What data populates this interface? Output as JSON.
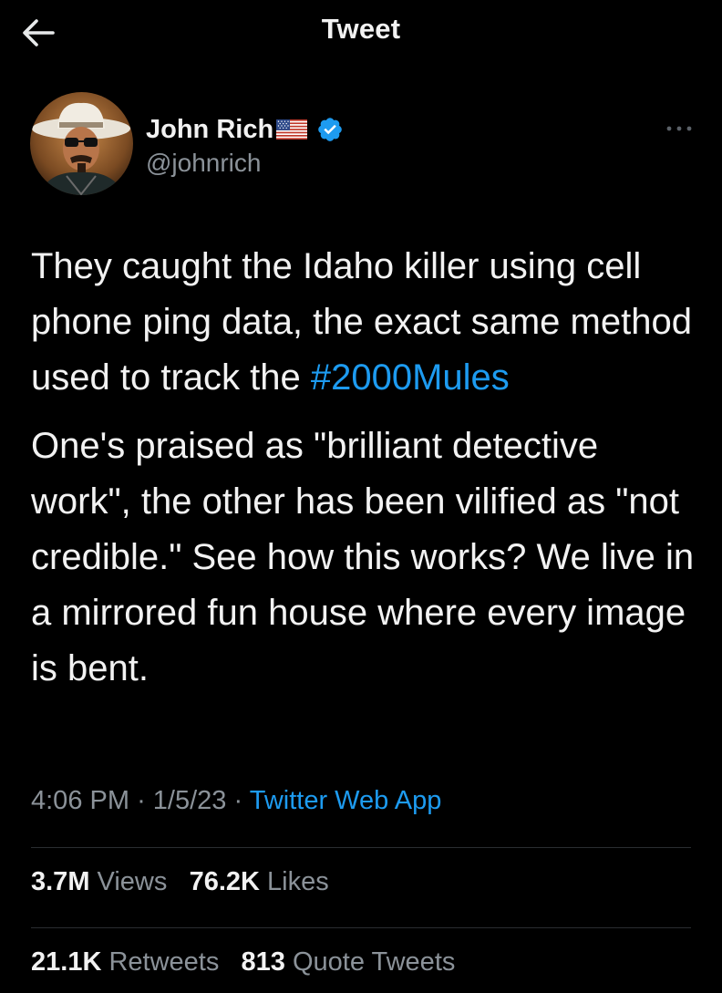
{
  "header": {
    "title": "Tweet",
    "back_icon": "arrow-left-icon"
  },
  "author": {
    "display_name": "John Rich",
    "handle": "@johnrich",
    "flag_icon": "us-flag-icon",
    "verified_icon": "verified-badge-icon",
    "verified_color": "#1d9bf0"
  },
  "tweet": {
    "paragraph1_text": "They caught the Idaho killer using cell phone ping data, the exact same method used to track the",
    "hashtag": "#2000Mules",
    "paragraph2": "One's praised as \"brilliant detective work\", the other has been vilified as \"not credible.\" See how this works? We live in a mirrored fun house where every image is bent."
  },
  "meta": {
    "time": "4:06 PM",
    "separator": "·",
    "date": "1/5/23",
    "source": "Twitter Web App"
  },
  "stats": {
    "views_count": "3.7M",
    "views_label": "Views",
    "likes_count": "76.2K",
    "likes_label": "Likes",
    "retweets_count": "21.1K",
    "retweets_label": "Retweets",
    "quotes_count": "813",
    "quotes_label": "Quote Tweets"
  },
  "colors": {
    "background": "#000000",
    "text": "#f2f2f2",
    "secondary": "#8b9299",
    "accent": "#1d9bf0"
  }
}
